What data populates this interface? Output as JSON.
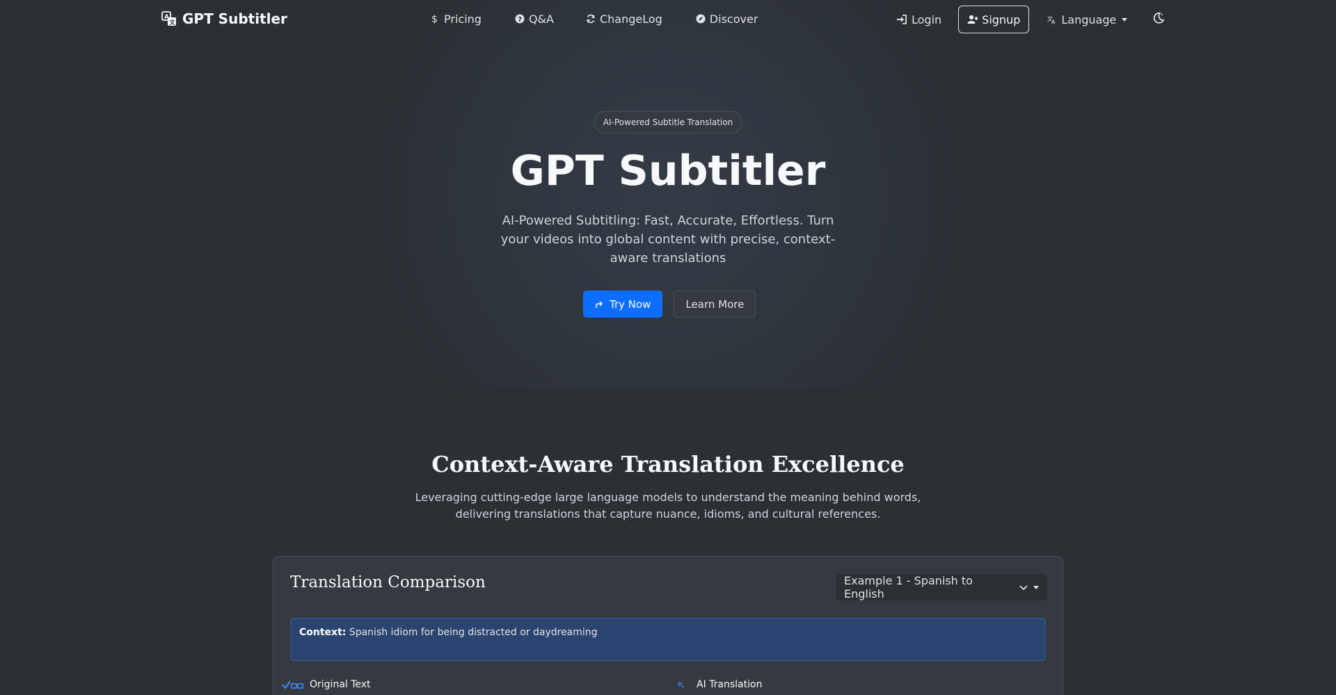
{
  "brand": {
    "name": "GPT Subtitler"
  },
  "nav": {
    "links": [
      {
        "label": "Pricing",
        "icon": "dollar-icon"
      },
      {
        "label": "Q&A",
        "icon": "question-circle-icon"
      },
      {
        "label": "ChangeLog",
        "icon": "refresh-icon"
      },
      {
        "label": "Discover",
        "icon": "compass-icon"
      }
    ],
    "login_label": "Login",
    "signup_label": "Signup",
    "language_label": "Language"
  },
  "hero": {
    "badge": "AI-Powered Subtitle Translation",
    "title": "GPT Subtitler",
    "subtitle": "AI-Powered Subtitling: Fast, Accurate, Effortless. Turn your videos into global content with precise, context-aware translations",
    "try_now": "Try Now",
    "learn_more": "Learn More"
  },
  "features": {
    "title": "Context-Aware Translation Excellence",
    "subtitle": "Leveraging cutting-edge large language models to understand the meaning behind words, delivering translations that capture nuance, idioms, and cultural references."
  },
  "comparison": {
    "title": "Translation Comparison",
    "selected_example": "Example 1 - Spanish to English",
    "context_label": "Context:",
    "context_text": "Spanish idiom for being distracted or daydreaming",
    "original_label": "Original Text",
    "ai_label": "AI Translation"
  },
  "colors": {
    "background": "#2b3035",
    "primary": "#0d6efd",
    "context_bg": "#2c4570"
  }
}
